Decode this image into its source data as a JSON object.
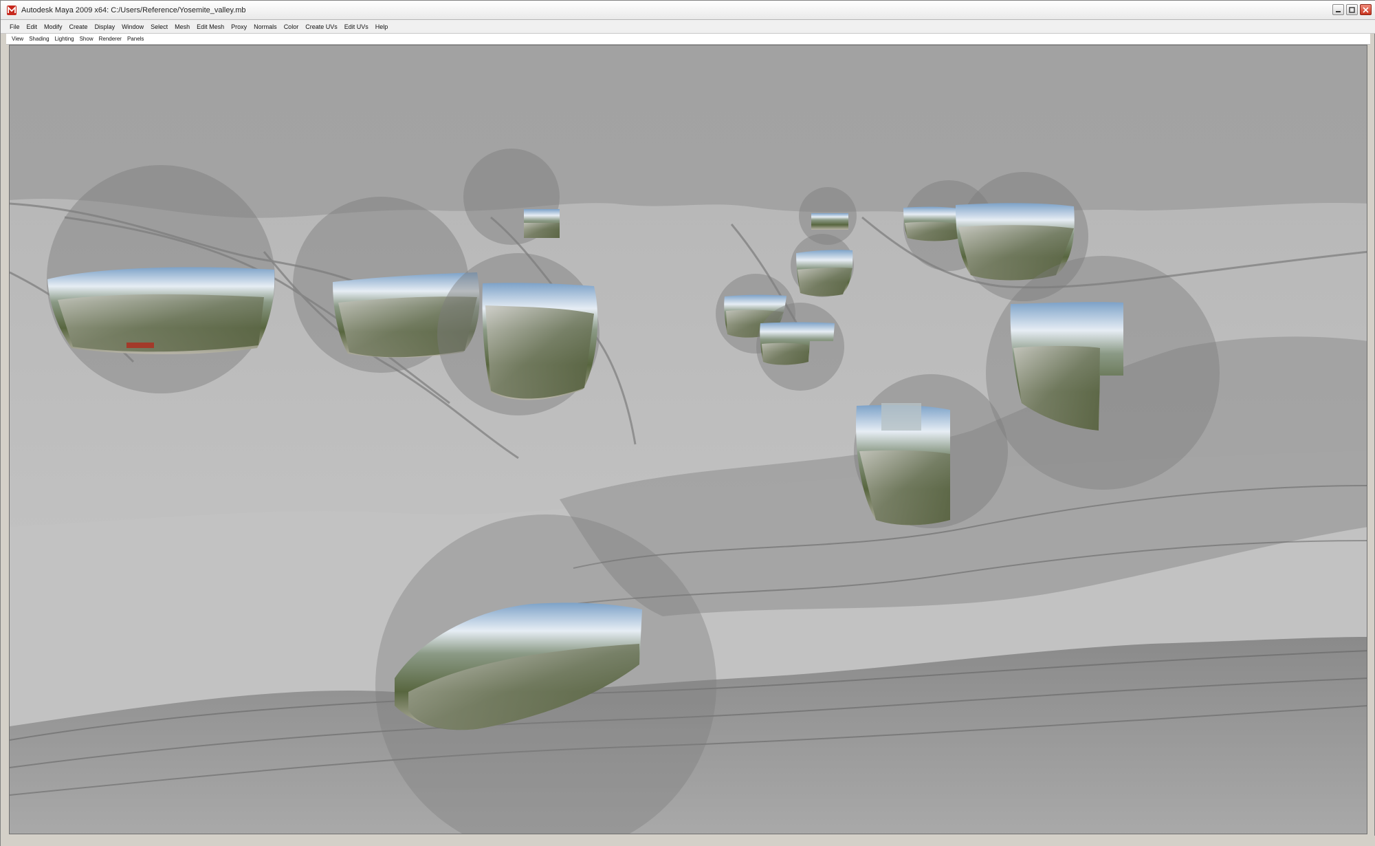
{
  "window": {
    "title": "Autodesk Maya 2009 x64: C:/Users/Reference/Yosemite_valley.mb"
  },
  "menubar": {
    "items": [
      "File",
      "Edit",
      "Modify",
      "Create",
      "Display",
      "Window",
      "Select",
      "Mesh",
      "Edit Mesh",
      "Proxy",
      "Normals",
      "Color",
      "Create UVs",
      "Edit UVs",
      "Help"
    ]
  },
  "panel_menu": {
    "items": [
      "View",
      "Shading",
      "Lighting",
      "Show",
      "Renderer",
      "Panels"
    ]
  },
  "colors": {
    "titlebar": "#f2f2f2",
    "menubar": "#f0f0f0",
    "viewport_sky": "#a4a4a4",
    "terrain": "#c4c4c4",
    "sphere_fill": "#7c7c7c",
    "close_button": "#c8341f"
  },
  "icons": {
    "app": "maya-app-icon",
    "minimize": "minimize-icon",
    "maximize": "maximize-icon",
    "close": "close-icon"
  }
}
